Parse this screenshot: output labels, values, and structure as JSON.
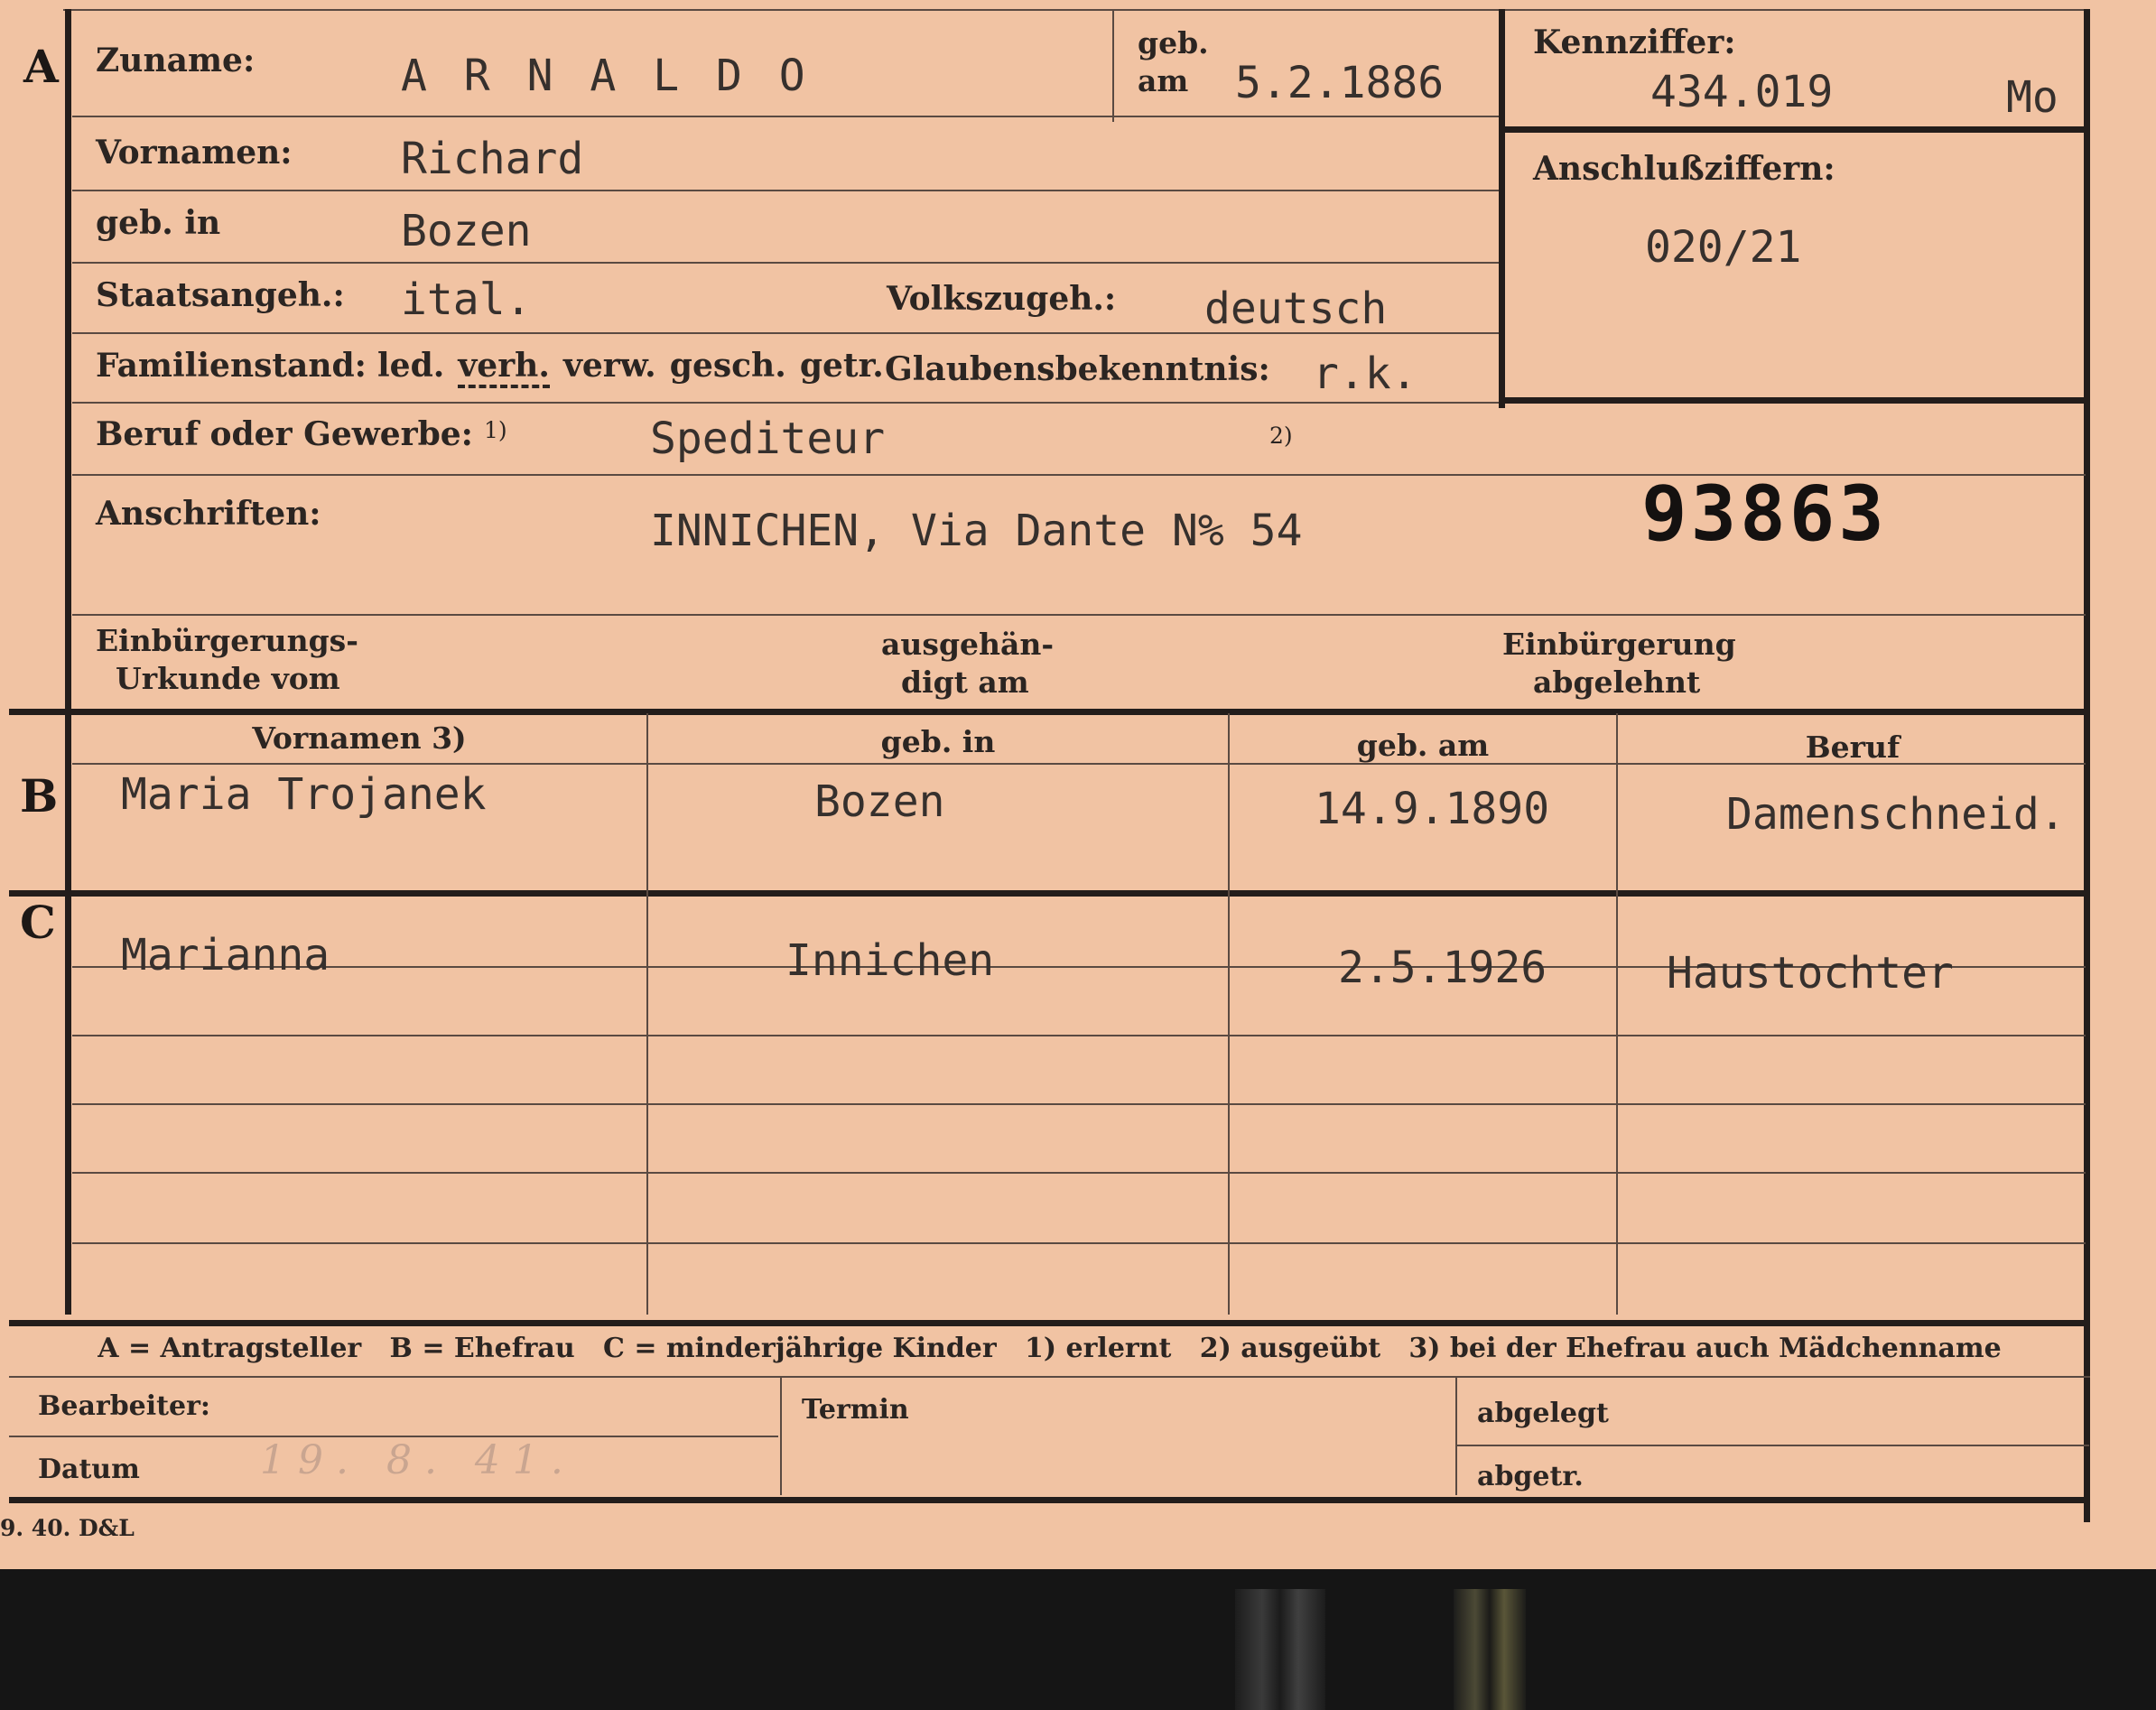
{
  "sections": {
    "a": "A",
    "b": "B",
    "c": "C"
  },
  "applicant": {
    "surname_label": "Zuname:",
    "surname": "A R N A L D O",
    "birth_date_label_1": "geb.",
    "birth_date_label_2": "am",
    "birth_date": "5.2.1886",
    "first_names_label": "Vornamen:",
    "first_names": "Richard",
    "birthplace_label": "geb. in",
    "birthplace": "Bozen",
    "citizenship_label": "Staatsangeh.:",
    "citizenship": "ital.",
    "ethnicity_label": "Volkszugeh.:",
    "ethnicity": "deutsch",
    "marital_label": "Familienstand:",
    "marital_options": [
      "led.",
      "verh.",
      "verw.",
      "gesch.",
      "getr."
    ],
    "marital_selected": "verh.",
    "religion_label": "Glaubensbekenntnis:",
    "religion": "r.k.",
    "occupation_label": "Beruf oder Gewerbe:",
    "occupation_note_1": "1)",
    "occupation": "Spediteur",
    "occupation_note_2": "2)",
    "address_label": "Anschriften:",
    "address": "INNICHEN, Via Dante N% 54",
    "file_number": "93863",
    "naturalization_doc_label_1": "Einbürgerungs-",
    "naturalization_doc_label_2": "Urkunde vom",
    "handed_over_label_1": "ausgehän-",
    "handed_over_label_2": "digt am",
    "naturalization_denied_label_1": "Einbürgerung",
    "naturalization_denied_label_2": "abgelehnt"
  },
  "reference": {
    "id_label": "Kennziffer:",
    "id_value": "434.019",
    "id_suffix": "Mo",
    "linked_label": "Anschlußziffern:",
    "linked_value": "020/21"
  },
  "family_table": {
    "headers": [
      "Vornamen 3)",
      "geb. in",
      "geb. am",
      "Beruf"
    ],
    "spouse": {
      "name": "Maria Trojanek",
      "birthplace": "Bozen",
      "birth_date": "14.9.1890",
      "occupation": "Damenschneid."
    },
    "children": [
      {
        "name": "Marianna",
        "birthplace": "Innichen",
        "birth_date": "2.5.1926",
        "occupation": "Haustochter"
      }
    ]
  },
  "legend": "A = Antragsteller   B = Ehefrau   C = minderjährige Kinder   1) erlernt   2) ausgeübt   3) bei der Ehefrau auch Mädchenname",
  "admin": {
    "clerk_label": "Bearbeiter:",
    "date_label": "Datum",
    "date_stamp": "19. 8. 41.",
    "deadline_label": "Termin",
    "filed_label": "abgelegt",
    "separated_label": "abgetr."
  },
  "print_mark": "9. 40. D&L"
}
